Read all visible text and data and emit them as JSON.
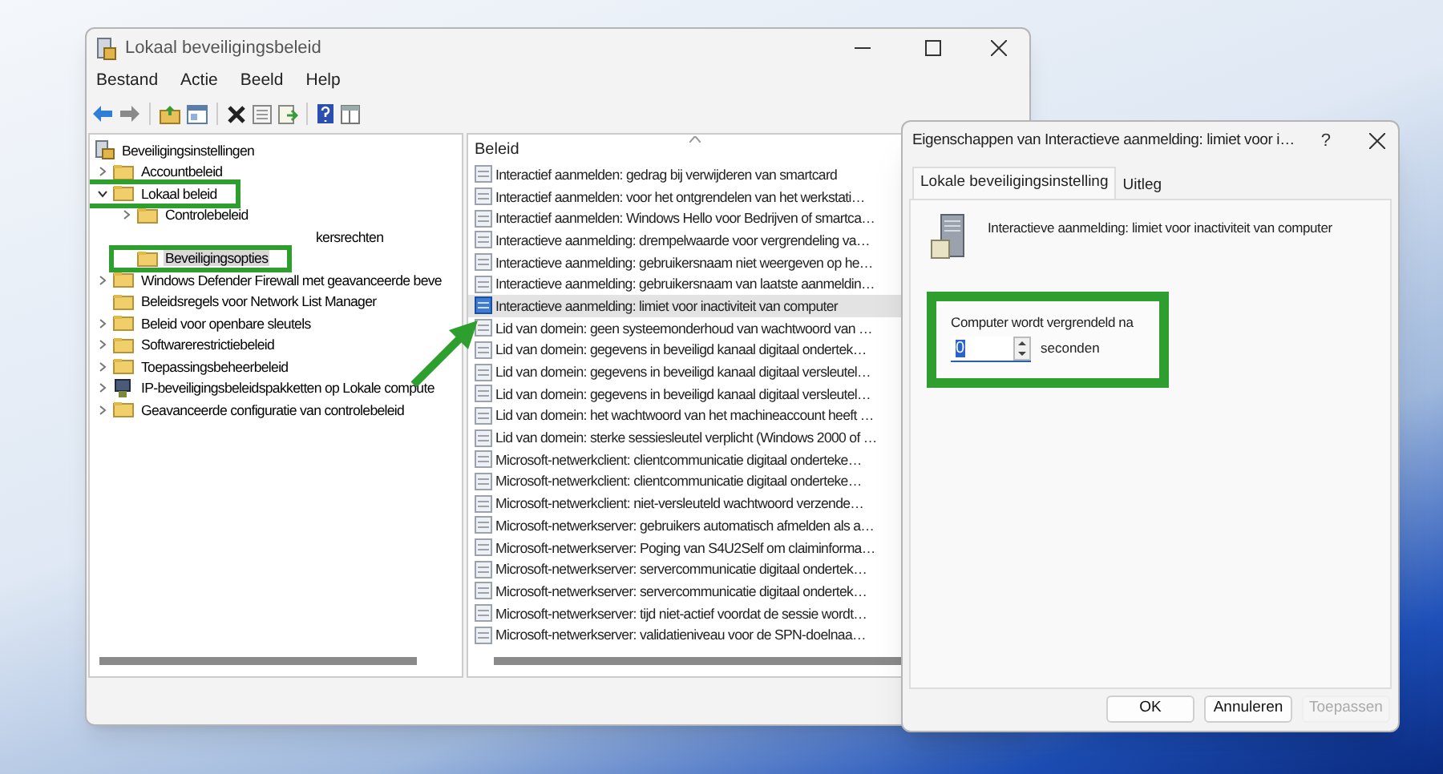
{
  "main_window": {
    "title": "Lokaal beveiligingsbeleid",
    "menu": [
      "Bestand",
      "Actie",
      "Beeld",
      "Help"
    ],
    "tree": [
      {
        "label": "Beveiligingsinstellingen",
        "kind": "root",
        "selected": false,
        "children": [
          {
            "label": "Accountbeleid",
            "kind": "folder",
            "expanded": false,
            "selected": false
          },
          {
            "label": "Lokaal beleid",
            "kind": "folder",
            "expanded": true,
            "selected": false,
            "highlighted": true,
            "children": [
              {
                "label": "Controlebeleid",
                "kind": "folder",
                "expanded": false,
                "selected": false
              },
              {
                "label": "kersrechten",
                "kind": "covered",
                "selected": false
              },
              {
                "label": "Beveiligingsopties",
                "kind": "folder",
                "selected": true,
                "highlighted": true
              }
            ]
          },
          {
            "label": "Windows Defender Firewall met geavanceerde beve",
            "kind": "folder",
            "expanded": false,
            "selected": false
          },
          {
            "label": "Beleidsregels voor Network List Manager",
            "kind": "folder",
            "selected": false
          },
          {
            "label": "Beleid voor openbare sleutels",
            "kind": "folder",
            "expanded": false,
            "selected": false
          },
          {
            "label": "Softwarerestrictiebeleid",
            "kind": "folder",
            "expanded": false,
            "selected": false
          },
          {
            "label": "Toepassingsbeheerbeleid",
            "kind": "folder",
            "expanded": false,
            "selected": false
          },
          {
            "label": "IP-beveiligingsbeleidspakketten op Lokale compute",
            "kind": "network",
            "expanded": false,
            "selected": false
          },
          {
            "label": "Geavanceerde configuratie van controlebeleid",
            "kind": "folder",
            "expanded": false,
            "selected": false
          }
        ]
      }
    ],
    "list": {
      "column": "Beleid",
      "rows": [
        {
          "text": "Interactief aanmelden: gedrag bij verwijderen van smartcard",
          "selected": false
        },
        {
          "text": "Interactief aanmelden: voor het ontgrendelen van het werkstati…",
          "selected": false
        },
        {
          "text": "Interactief aanmelden: Windows Hello voor Bedrijven of smartca…",
          "selected": false
        },
        {
          "text": "Interactieve aanmelding: drempelwaarde voor vergrendeling va…",
          "selected": false
        },
        {
          "text": "Interactieve aanmelding: gebruikersnaam niet weergeven op he…",
          "selected": false
        },
        {
          "text": "Interactieve aanmelding: gebruikersnaam van laatste aanmeldin…",
          "selected": false
        },
        {
          "text": "Interactieve aanmelding: limiet voor inactiviteit van computer",
          "selected": true
        },
        {
          "text": "Lid van domein: geen systeemonderhoud van wachtwoord van …",
          "selected": false
        },
        {
          "text": "Lid van domein: gegevens in beveiligd kanaal digitaal ondertek…",
          "selected": false
        },
        {
          "text": "Lid van domein: gegevens in beveiligd kanaal digitaal versleutel…",
          "selected": false
        },
        {
          "text": "Lid van domein: gegevens in beveiligd kanaal digitaal versleutel…",
          "selected": false
        },
        {
          "text": "Lid van domein: het wachtwoord van het machineaccount heeft …",
          "selected": false
        },
        {
          "text": "Lid van domein: sterke sessiesleutel verplicht (Windows 2000 of …",
          "selected": false
        },
        {
          "text": "Microsoft-netwerkclient: clientcommunicatie digitaal onderteke…",
          "selected": false
        },
        {
          "text": "Microsoft-netwerkclient: clientcommunicatie digitaal onderteke…",
          "selected": false
        },
        {
          "text": "Microsoft-netwerkclient: niet-versleuteld wachtwoord verzende…",
          "selected": false
        },
        {
          "text": "Microsoft-netwerkserver: gebruikers automatisch afmelden als a…",
          "selected": false
        },
        {
          "text": "Microsoft-netwerkserver: Poging van S4U2Self om claiminforma…",
          "selected": false
        },
        {
          "text": "Microsoft-netwerkserver: servercommunicatie digitaal ondertek…",
          "selected": false
        },
        {
          "text": "Microsoft-netwerkserver: servercommunicatie digitaal ondertek…",
          "selected": false
        },
        {
          "text": "Microsoft-netwerkserver: tijd niet-actief voordat de sessie wordt…",
          "selected": false
        },
        {
          "text": "Microsoft-netwerkserver: validatieniveau voor de SPN-doelnaa…",
          "selected": false
        }
      ]
    }
  },
  "dialog": {
    "title": "Eigenschappen van Interactieve aanmelding: limiet voor i…",
    "help": "?",
    "tabs": [
      {
        "label": "Lokale beveiligingsinstelling",
        "selected": true
      },
      {
        "label": "Uitleg",
        "selected": false
      }
    ],
    "policy_name": "Interactieve aanmelding: limiet voor inactiviteit van computer",
    "field": {
      "label": "Computer wordt vergrendeld na",
      "value": "0",
      "unit": "seconden"
    },
    "buttons": [
      {
        "label": "OK",
        "disabled": false
      },
      {
        "label": "Annuleren",
        "disabled": false
      },
      {
        "label": "Toepassen",
        "disabled": true
      }
    ]
  }
}
